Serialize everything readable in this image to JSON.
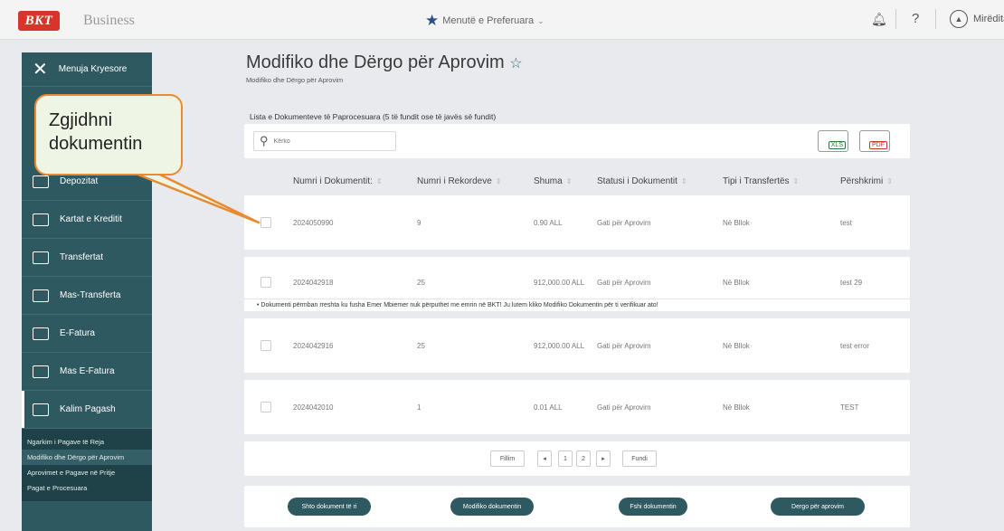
{
  "topbar": {
    "logo": "BKT",
    "brand": "Business",
    "favorites_menu": "Menutë e Preferuara",
    "greeting": "Mirëdita"
  },
  "sidebar": {
    "close_label": "Menuja Kryesore",
    "items": [
      {
        "label": "Depozitat"
      },
      {
        "label": "Kartat e Kreditit"
      },
      {
        "label": "Transfertat"
      },
      {
        "label": "Mas-Transferta"
      },
      {
        "label": "E-Fatura"
      },
      {
        "label": "Mas E-Fatura"
      },
      {
        "label": "Kalim Pagash"
      }
    ],
    "subitems": [
      {
        "label": "Ngarkim i Pagave të Reja"
      },
      {
        "label": "Modifiko dhe Dërgo për Aprovim"
      },
      {
        "label": "Aprovimet e Pagave në Pritje"
      },
      {
        "label": "Pagat e Procesuara"
      }
    ]
  },
  "page": {
    "title": "Modifiko dhe Dërgo për Aprovim",
    "breadcrumb": "Modifiko dhe Dërgo për Aprovim",
    "list_title": "Lista e Dokumenteve të Paprocesuara (5 të fundit ose të javës së fundit)",
    "search_placeholder": "Kërko",
    "export_xls": "XLS",
    "export_pdf": "PDF"
  },
  "table": {
    "columns": [
      "Numri i Dokumentit:",
      "Numri i Rekordeve",
      "Shuma",
      "Statusi i Dokumentit",
      "Tipi i Transfertës",
      "Përshkrimi"
    ],
    "rows": [
      {
        "doc": "2024050990",
        "records": "9",
        "amount": "0.90 ALL",
        "status": "Gati për Aprovim",
        "type": "Në Bllok",
        "desc": "test"
      },
      {
        "doc": "2024042918",
        "records": "25",
        "amount": "912,000.00 ALL",
        "status": "Gati për Aprovim",
        "type": "Në Bllok",
        "desc": "test 29"
      },
      {
        "doc": "2024042916",
        "records": "25",
        "amount": "912,000.00 ALL",
        "status": "Gati për Aprovim",
        "type": "Në Bllok",
        "desc": "test error"
      },
      {
        "doc": "2024042010",
        "records": "1",
        "amount": "0.01 ALL",
        "status": "Gati për Aprovim",
        "type": "Në Bllok",
        "desc": "TEST"
      }
    ],
    "warning": "Dokumenti përmban rreshta ku fusha Emer Mbiemer nuk përputhet me emrin në BKT! Ju lutem kliko Modifiko Dokumentin për ti verifikuar ato!"
  },
  "pager": {
    "first": "Fillim",
    "prev": "◂",
    "page1": "1",
    "page2": "2",
    "next": "▸",
    "last": "Fundi"
  },
  "actions": {
    "add": "Shto dokument të ri",
    "edit": "Modifiko dokumentin",
    "delete": "Fshi dokumentin",
    "send": "Dergo për aprovim"
  },
  "callout": {
    "text": "Zgjidhni dokumentin"
  },
  "colors": {
    "sidebar": "#2e5960",
    "callout_border": "#e88a30",
    "callout_fill": "#eef5e4",
    "brand_red": "#d8352a"
  }
}
